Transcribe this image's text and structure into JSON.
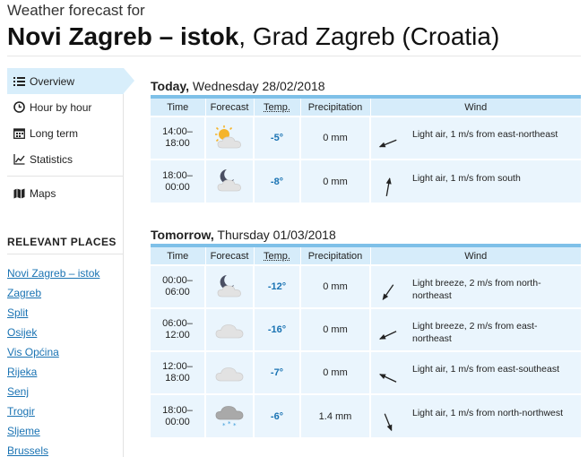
{
  "header": {
    "subtitle": "Weather forecast for",
    "location_bold": "Novi Zagreb – istok",
    "location_rest": ", Grad Zagreb (Croatia)"
  },
  "sidebar": {
    "nav": [
      {
        "label": "Overview",
        "icon": "list-icon",
        "active": true
      },
      {
        "label": "Hour by hour",
        "icon": "clock-icon"
      },
      {
        "label": "Long term",
        "icon": "calendar-icon"
      },
      {
        "label": "Statistics",
        "icon": "chart-icon"
      },
      {
        "label": "Maps",
        "icon": "map-icon"
      }
    ],
    "relevant_heading": "RELEVANT PLACES",
    "places": [
      "Novi Zagreb – istok",
      "Zagreb",
      "Split",
      "Osijek",
      "Vis Općina",
      "Rijeka",
      "Senj",
      "Trogir",
      "Sljeme",
      "Brussels"
    ]
  },
  "columns": {
    "time": "Time",
    "forecast": "Forecast",
    "temp": "Temp.",
    "precip": "Precipitation",
    "wind": "Wind"
  },
  "days": [
    {
      "label": "Today,",
      "date": " Wednesday 28/02/2018",
      "rows": [
        {
          "time_from": "14:00–",
          "time_to": "18:00",
          "icon": "sun-cloud-icon",
          "temp": "-5°",
          "precip": "0 mm",
          "wind": "Light air, 1 m/s from east-northeast",
          "wind_dir": "east-northeast"
        },
        {
          "time_from": "18:00–",
          "time_to": "00:00",
          "icon": "moon-cloud-icon",
          "temp": "-8°",
          "precip": "0 mm",
          "wind": "Light air, 1 m/s from south",
          "wind_dir": "south"
        }
      ]
    },
    {
      "label": "Tomorrow,",
      "date": " Thursday 01/03/2018",
      "rows": [
        {
          "time_from": "00:00–",
          "time_to": "06:00",
          "icon": "moon-cloud-icon",
          "temp": "-12°",
          "precip": "0 mm",
          "wind": "Light breeze, 2 m/s from north-northeast",
          "wind_dir": "north-northeast"
        },
        {
          "time_from": "06:00–",
          "time_to": "12:00",
          "icon": "cloud-icon",
          "temp": "-16°",
          "precip": "0 mm",
          "wind": "Light breeze, 2 m/s from east-northeast",
          "wind_dir": "east-northeast"
        },
        {
          "time_from": "12:00–",
          "time_to": "18:00",
          "icon": "cloud-icon",
          "temp": "-7°",
          "precip": "0 mm",
          "wind": "Light air, 1 m/s from east-southeast",
          "wind_dir": "east-southeast"
        },
        {
          "time_from": "18:00–",
          "time_to": "00:00",
          "icon": "snow-cloud-icon",
          "temp": "-6°",
          "precip": "1.4 mm",
          "wind": "Light air, 1 m/s from north-northwest",
          "wind_dir": "north-northwest"
        }
      ]
    }
  ],
  "colors": {
    "accent": "#1a73b3",
    "header_bg": "#d6ecfa",
    "row_bg": "#eaf5fd",
    "day_bar": "#7ec0e8",
    "active_nav": "#d8eefb"
  }
}
